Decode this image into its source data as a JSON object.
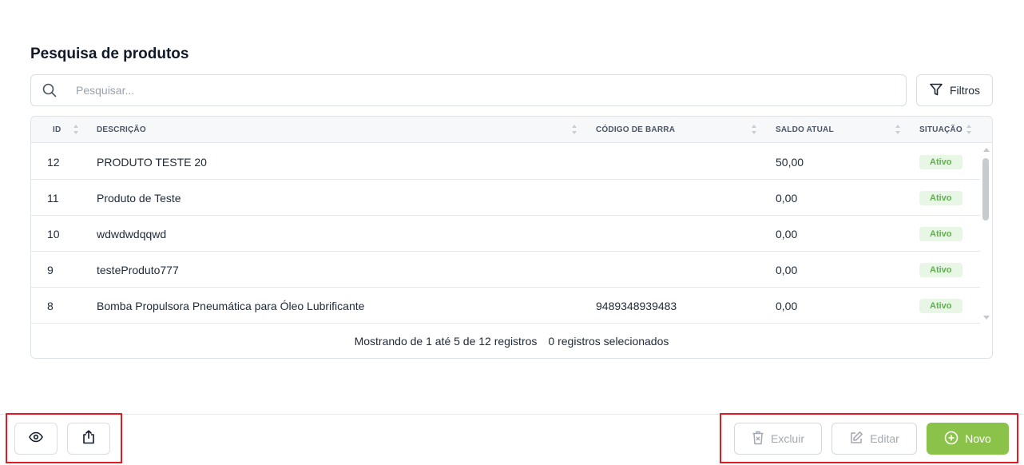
{
  "page": {
    "title": "Pesquisa de produtos"
  },
  "search": {
    "placeholder": "Pesquisar...",
    "value": ""
  },
  "filters": {
    "label": "Filtros"
  },
  "table": {
    "columns": {
      "id": "ID",
      "description": "DESCRIÇÃO",
      "barcode": "CÓDIGO DE BARRA",
      "balance": "SALDO ATUAL",
      "status": "SITUAÇÃO"
    },
    "rows": [
      {
        "id": "12",
        "description": "PRODUTO TESTE 20",
        "barcode": "",
        "balance": "50,00",
        "status": "Ativo"
      },
      {
        "id": "11",
        "description": "Produto de Teste",
        "barcode": "",
        "balance": "0,00",
        "status": "Ativo"
      },
      {
        "id": "10",
        "description": "wdwdwdqqwd",
        "barcode": "",
        "balance": "0,00",
        "status": "Ativo"
      },
      {
        "id": "9",
        "description": "testeProduto777",
        "barcode": "",
        "balance": "0,00",
        "status": "Ativo"
      },
      {
        "id": "8",
        "description": "Bomba Propulsora Pneumática para Óleo Lubrificante",
        "barcode": "9489348939483",
        "balance": "0,00",
        "status": "Ativo"
      }
    ],
    "footer": {
      "showing": "Mostrando de 1 até 5 de 12 registros",
      "selected": "0 registros selecionados"
    }
  },
  "actions": {
    "delete_label": "Excluir",
    "edit_label": "Editar",
    "new_label": "Novo"
  },
  "colors": {
    "primary": "#8bc34a",
    "active_badge_bg": "#e7f6e5",
    "active_badge_text": "#5fb04f",
    "highlight": "#e01b24"
  },
  "icons": {
    "search": "search-icon",
    "filter": "filter-icon",
    "view": "eye-icon",
    "export": "share-icon",
    "delete": "trash-icon",
    "edit": "pencil-icon",
    "new": "plus-circle-icon"
  }
}
